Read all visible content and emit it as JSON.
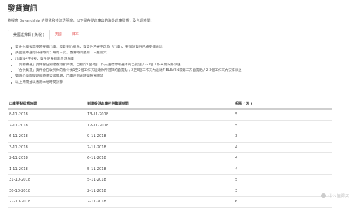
{
  "page": {
    "title": "發貨資訊",
    "intro": "為提高 Buyandship 的發貨和物流透明度，以下是各從倉庫出的海外倉庫發貨，及包運時間："
  },
  "tabs": [
    {
      "label": "美國送貨轉 ( 免稅 )",
      "active": true
    },
    {
      "label": "美國",
      "active": false
    },
    {
      "label": "日本",
      "active": false
    }
  ],
  "notes": [
    "貨件入庫後需要時安排出庫：發貨到心機倉，貨貨件若被更改為「出庫」，要預設貨件已被安排送達",
    "美國倉庫逢周日運時間：每周三次，香港時間星期二三星期六",
    "出庫後4至6天，貨件便會到達香港倉庫",
    "「到數轉運」貨件會在到達香港倉庫後，自動於1至2個工作天送達你所選擇的自提點 / 2-3個工作天內安排派送",
    "「合併集運」貨件會在收到你的指令後1至2個工作天送達你所選擇的自提點 / 2至3個工作天內送達7-ELEVEN或第三方自提點 / 2-3個工作天內安排派送",
    "如遇上美國假期或香港公眾假期，出庫及到運時間將會順延",
    "以上時間並以香港本地時間計算"
  ],
  "table": {
    "headers": [
      "出庫要點狀態時間",
      "到達香港倉庫可供集運時間",
      "相隔 ( 天 )"
    ],
    "rows": [
      [
        "8-11-2018",
        "13-11-2018",
        "5"
      ],
      [
        "7-11-2018",
        "12-11-2018",
        "5"
      ],
      [
        "6-11-2018",
        "9-11-2018",
        "3"
      ],
      [
        "3-11-2018",
        "7-11-2018",
        "4"
      ],
      [
        "2-11-2018",
        "6-11-2018",
        "4"
      ],
      [
        "1-11-2018",
        "5-11-2018",
        "4"
      ],
      [
        "31-10-2018",
        "5-11-2018",
        "5"
      ],
      [
        "30-10-2018",
        "2-11-2018",
        "3"
      ],
      [
        "27-10-2018",
        "2-11-2018",
        "6"
      ]
    ]
  },
  "watermark": "什么值得买"
}
